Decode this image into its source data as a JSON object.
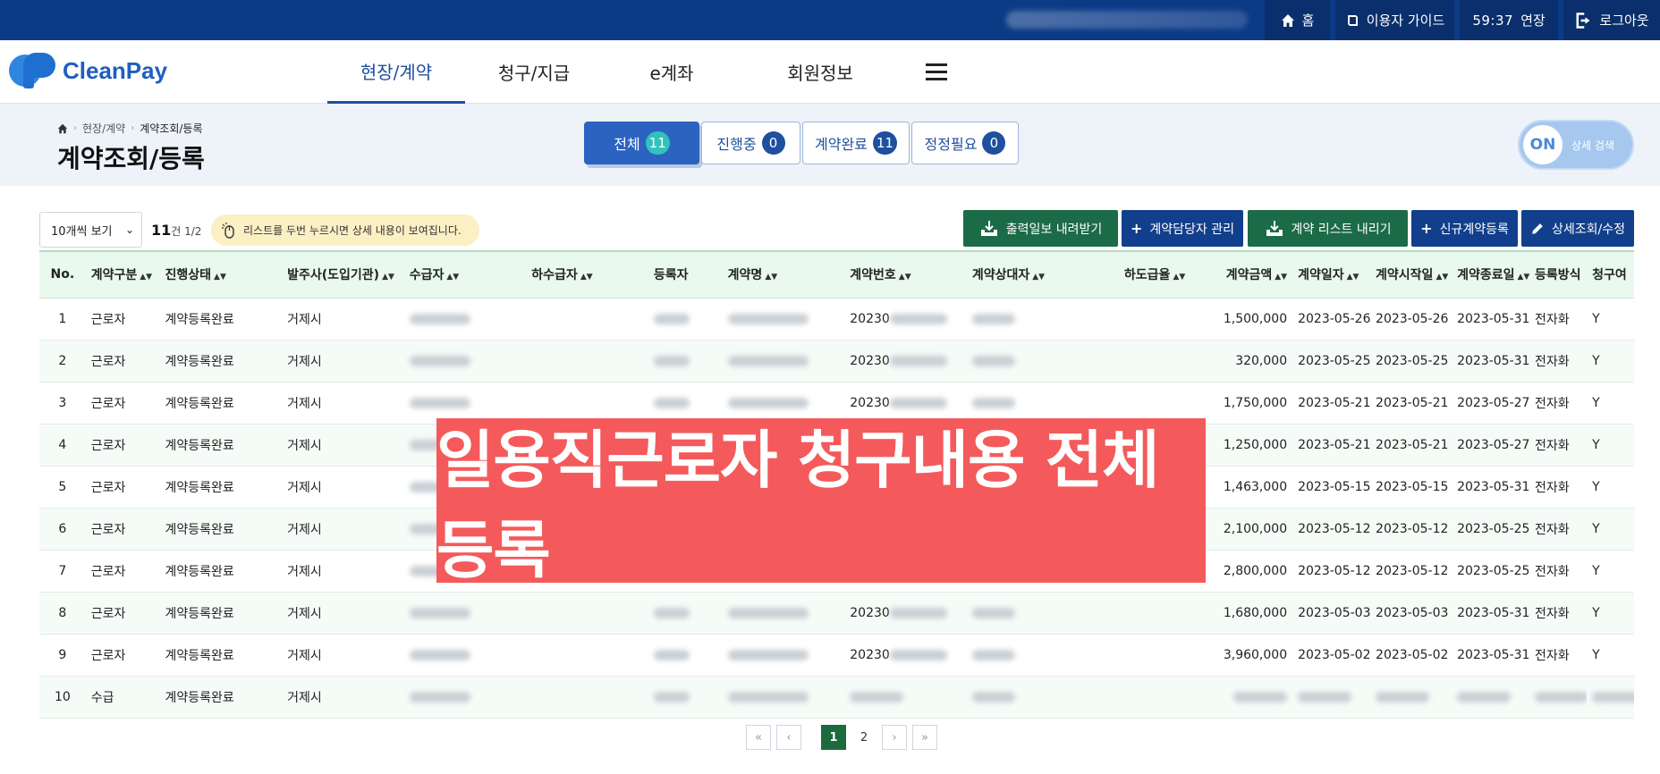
{
  "topbar": {
    "home_label": "홈",
    "guide_label": "이용자 가이드",
    "timer": "59:37",
    "extend_label": "연장",
    "logout_label": "로그아웃"
  },
  "header": {
    "logo_text": "CleanPay",
    "nav": [
      "현장/계약",
      "청구/지급",
      "e계좌",
      "회원정보"
    ]
  },
  "subheader": {
    "breadcrumb": [
      "현장/계약",
      "계약조회/등록"
    ],
    "title": "계약조회/등록",
    "tabs": [
      {
        "label": "전체",
        "count": "11"
      },
      {
        "label": "진행중",
        "count": "0"
      },
      {
        "label": "계약완료",
        "count": "11"
      },
      {
        "label": "정정필요",
        "count": "0"
      }
    ],
    "toggle": {
      "state": "ON",
      "label": "상세 검색"
    }
  },
  "toolbar": {
    "perpage": "10개씩 보기",
    "total_count": "11",
    "total_suffix": "건 1/2",
    "hint": "리스트를 두번 누르시면 상세 내용이 보여집니다.",
    "buttons": [
      "출력일보 내려받기",
      "계약담당자 관리",
      "계약 리스트 내리기",
      "신규계약등록",
      "상세조회/수정"
    ]
  },
  "table": {
    "columns": [
      "No.",
      "계약구분",
      "진행상태",
      "발주사(도입기관)",
      "수급자",
      "하수급자",
      "등록자",
      "계약명",
      "계약번호",
      "계약상대자",
      "하도급율",
      "계약금액",
      "계약일자",
      "계약시작일",
      "계약종료일",
      "등록방식",
      "청구여"
    ],
    "rows": [
      {
        "no": "1",
        "type": "근로자",
        "status": "계약등록완료",
        "client": "거제시",
        "contract_no": "20230",
        "amount": "1,500,000",
        "date": "2023-05-26",
        "start": "2023-05-26",
        "end": "2023-05-31",
        "method": "전자화",
        "claim": "Y"
      },
      {
        "no": "2",
        "type": "근로자",
        "status": "계약등록완료",
        "client": "거제시",
        "contract_no": "20230",
        "amount": "320,000",
        "date": "2023-05-25",
        "start": "2023-05-25",
        "end": "2023-05-31",
        "method": "전자화",
        "claim": "Y"
      },
      {
        "no": "3",
        "type": "근로자",
        "status": "계약등록완료",
        "client": "거제시",
        "contract_no": "20230",
        "amount": "1,750,000",
        "date": "2023-05-21",
        "start": "2023-05-21",
        "end": "2023-05-27",
        "method": "전자화",
        "claim": "Y"
      },
      {
        "no": "4",
        "type": "근로자",
        "status": "계약등록완료",
        "client": "거제시",
        "contract_no": "",
        "amount": "1,250,000",
        "date": "2023-05-21",
        "start": "2023-05-21",
        "end": "2023-05-27",
        "method": "전자화",
        "claim": "Y"
      },
      {
        "no": "5",
        "type": "근로자",
        "status": "계약등록완료",
        "client": "거제시",
        "contract_no": "",
        "amount": "1,463,000",
        "date": "2023-05-15",
        "start": "2023-05-15",
        "end": "2023-05-31",
        "method": "전자화",
        "claim": "Y"
      },
      {
        "no": "6",
        "type": "근로자",
        "status": "계약등록완료",
        "client": "거제시",
        "contract_no": "",
        "amount": "2,100,000",
        "date": "2023-05-12",
        "start": "2023-05-12",
        "end": "2023-05-25",
        "method": "전자화",
        "claim": "Y"
      },
      {
        "no": "7",
        "type": "근로자",
        "status": "계약등록완료",
        "client": "거제시",
        "contract_no": "",
        "amount": "2,800,000",
        "date": "2023-05-12",
        "start": "2023-05-12",
        "end": "2023-05-25",
        "method": "전자화",
        "claim": "Y"
      },
      {
        "no": "8",
        "type": "근로자",
        "status": "계약등록완료",
        "client": "거제시",
        "contract_no": "20230",
        "amount": "1,680,000",
        "date": "2023-05-03",
        "start": "2023-05-03",
        "end": "2023-05-31",
        "method": "전자화",
        "claim": "Y"
      },
      {
        "no": "9",
        "type": "근로자",
        "status": "계약등록완료",
        "client": "거제시",
        "contract_no": "20230",
        "amount": "3,960,000",
        "date": "2023-05-02",
        "start": "2023-05-02",
        "end": "2023-05-31",
        "method": "전자화",
        "claim": "Y"
      },
      {
        "no": "10",
        "type": "수급",
        "status": "계약등록완료",
        "client": "거제시",
        "contract_no": "",
        "amount": "",
        "date": "",
        "start": "",
        "end": "",
        "method": "",
        "claim": ""
      }
    ]
  },
  "banner": "일용직근로자 청구내용 전체 등록",
  "pagination": {
    "pages": [
      "1",
      "2"
    ],
    "current": "1"
  },
  "colors": {
    "topbar": "#0c3b86",
    "accent": "#2c63c0",
    "green_button": "#1c6b47",
    "banner": "#f45a5b"
  }
}
